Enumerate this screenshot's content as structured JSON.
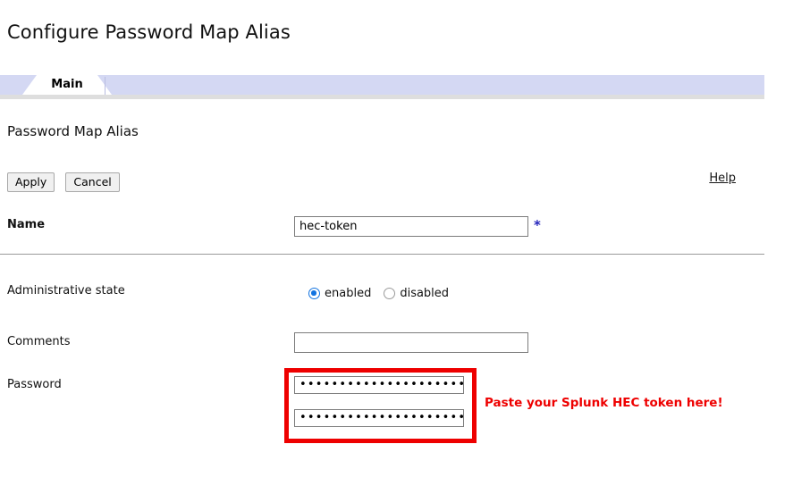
{
  "page": {
    "title": "Configure Password Map Alias",
    "section_heading": "Password Map Alias"
  },
  "tabs": [
    {
      "label": "Main",
      "selected": true
    }
  ],
  "toolbar": {
    "apply_label": "Apply",
    "cancel_label": "Cancel",
    "help_label": "Help"
  },
  "form": {
    "name": {
      "label": "Name",
      "value": "hec-token",
      "placeholder": "",
      "required_marker": "*"
    },
    "administrative_state": {
      "label": "Administrative state",
      "options": [
        {
          "label": "enabled",
          "selected": true
        },
        {
          "label": "disabled",
          "selected": false
        }
      ]
    },
    "comments": {
      "label": "Comments",
      "value": "",
      "placeholder": ""
    },
    "password": {
      "label": "Password",
      "value": "•••••••••••••••••••••••••",
      "confirm_value": "•••••••••••••••••••••••••"
    }
  },
  "annotations": {
    "paste_note": "Paste your Splunk HEC token here!"
  },
  "colors": {
    "tab_bar": "#d4d8f3",
    "accent_blue": "#1273e0",
    "required_star": "#2424bb",
    "annotation_red": "#ee0000",
    "separator": "#9a9a9a"
  }
}
